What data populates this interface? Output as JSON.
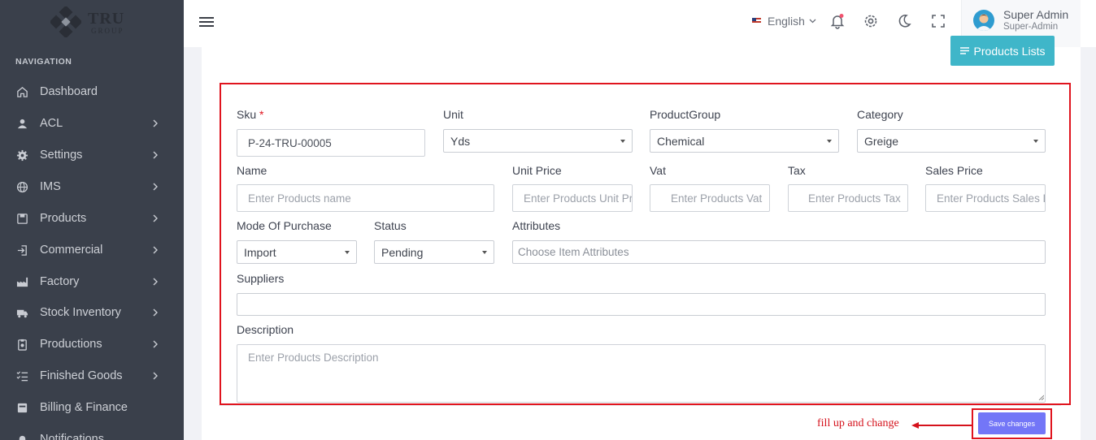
{
  "brand": {
    "name": "TRU",
    "sub": "GROUP"
  },
  "sidebar": {
    "heading": "NAVIGATION",
    "items": [
      {
        "label": "Dashboard",
        "icon": "home-icon",
        "chevron": false
      },
      {
        "label": "ACL",
        "icon": "user-icon",
        "chevron": true
      },
      {
        "label": "Settings",
        "icon": "gear-icon",
        "chevron": true
      },
      {
        "label": "IMS",
        "icon": "globe-icon",
        "chevron": true
      },
      {
        "label": "Products",
        "icon": "save-icon",
        "chevron": true
      },
      {
        "label": "Commercial",
        "icon": "login-icon",
        "chevron": true
      },
      {
        "label": "Factory",
        "icon": "factory-icon",
        "chevron": true
      },
      {
        "label": "Stock Inventory",
        "icon": "truck-icon",
        "chevron": true
      },
      {
        "label": "Productions",
        "icon": "clipboard-icon",
        "chevron": true
      },
      {
        "label": "Finished Goods",
        "icon": "checklist-icon",
        "chevron": true
      },
      {
        "label": "Billing & Finance",
        "icon": "bill-icon",
        "chevron": false
      },
      {
        "label": "Notifications",
        "icon": "bell-icon",
        "chevron": false
      }
    ]
  },
  "topbar": {
    "language": "English",
    "user_name": "Super Admin",
    "user_role": "Super-Admin"
  },
  "page": {
    "products_list_button": "Products Lists"
  },
  "form": {
    "sku": {
      "label": "Sku",
      "required_mark": "*",
      "value": "P-24-TRU-00005"
    },
    "unit": {
      "label": "Unit",
      "value": "Yds"
    },
    "product_group": {
      "label": "ProductGroup",
      "value": "Chemical"
    },
    "category": {
      "label": "Category",
      "value": "Greige"
    },
    "name": {
      "label": "Name",
      "placeholder": "Enter Products name"
    },
    "unit_price": {
      "label": "Unit Price",
      "placeholder": "Enter Products Unit Price"
    },
    "vat": {
      "label": "Vat",
      "placeholder": "Enter Products Vat"
    },
    "tax": {
      "label": "Tax",
      "placeholder": "Enter Products Tax"
    },
    "sales_price": {
      "label": "Sales Price",
      "placeholder": "Enter Products Sales Price"
    },
    "mode_of_purchase": {
      "label": "Mode Of Purchase",
      "value": "Import"
    },
    "status": {
      "label": "Status",
      "value": "Pending"
    },
    "attributes": {
      "label": "Attributes",
      "placeholder": "Choose Item Attributes"
    },
    "suppliers": {
      "label": "Suppliers",
      "value": ""
    },
    "description": {
      "label": "Description",
      "placeholder": "Enter Products Description"
    }
  },
  "footer": {
    "save_label": "Save changes"
  },
  "annotation": {
    "text": "fill up and change"
  },
  "colors": {
    "sidebar_bg": "#3a404b",
    "accent_cyan": "#3fb6c9",
    "save_purple": "#7376f7",
    "highlight_red": "#e0141e"
  }
}
